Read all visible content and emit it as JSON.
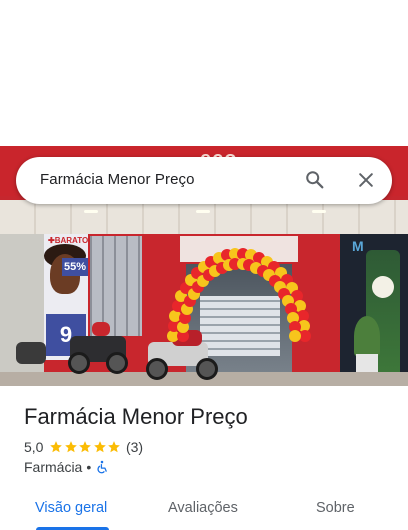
{
  "search": {
    "query": "Farmácia Menor Preço"
  },
  "place": {
    "name": "Farmácia Menor Preço",
    "rating": "5,0",
    "rating_value": 5.0,
    "review_count": "(3)",
    "category": "Farmácia",
    "separator": "•",
    "accessibility_icon": "wheelchair-icon"
  },
  "photo": {
    "storefront_sign_fragment": "eço",
    "poster_tag": "✚BARATO",
    "poster_price": "9",
    "poster_percent": "55%",
    "banner_fragment": "M"
  },
  "tabs": [
    {
      "label": "Visão geral",
      "active": true
    },
    {
      "label": "Avaliações",
      "active": false
    },
    {
      "label": "Sobre",
      "active": false
    }
  ],
  "colors": {
    "accent": "#1a73e8",
    "star": "#fbbc04",
    "text_primary": "#202124",
    "text_secondary": "#3c4043"
  },
  "icons": {
    "search": "search-icon",
    "close": "close-icon",
    "star": "star-icon"
  }
}
